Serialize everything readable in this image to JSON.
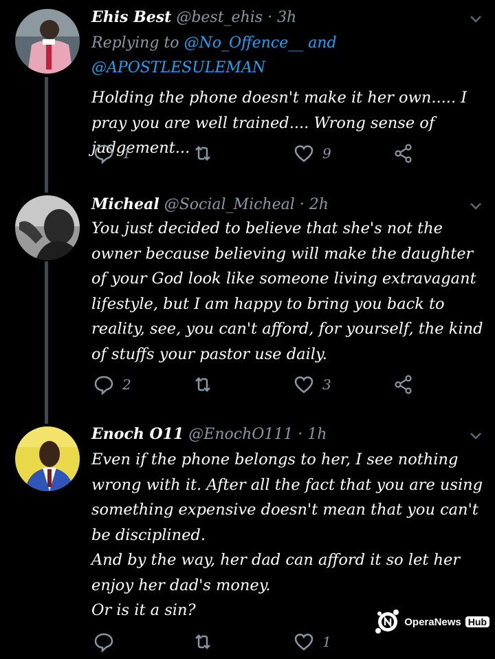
{
  "tweets": [
    {
      "name": "Ehis Best",
      "handle": "@best_ehis",
      "separator": "·",
      "time": "3h",
      "replying_prefix": "Replying to",
      "mention_1": "@No_Offence__",
      "mention_joiner": "and",
      "mention_2": "@APOSTLESULEMAN",
      "body": "Holding the phone doesn't make it her own..... I pray you are well trained.... Wrong sense of judgement...",
      "reply_count": "1",
      "retweet_count": "",
      "like_count": "9"
    },
    {
      "name": "Micheal",
      "handle": "@Social_Micheal",
      "separator": "·",
      "time": "2h",
      "body": "You just decided to believe that she's not the owner because believing will make the daughter of your God look like someone living extravagant lifestyle, but I am happy to bring you back to reality,  see, you can't afford, for yourself, the kind of stuffs your pastor use daily.",
      "reply_count": "2",
      "retweet_count": "",
      "like_count": "3"
    },
    {
      "name": "Enoch O11",
      "handle": "@EnochO111",
      "separator": "·",
      "time": "1h",
      "body": "Even if the phone belongs to her, I see nothing wrong with it. After all the fact that you are using something expensive doesn't mean that you can't be disciplined.\nAnd by the way, her dad can afford it so let her enjoy her dad's money.\nOr is it a sin?",
      "reply_count": "",
      "retweet_count": "",
      "like_count": "1"
    }
  ],
  "watermark": {
    "text": "OperaNews",
    "hub": "Hub"
  },
  "colors": {
    "background": "#000000",
    "secondary_text": "#8899a6",
    "link": "#1da1f2",
    "thread_line": "#3d4a55"
  },
  "icons": [
    "reply-icon",
    "retweet-icon",
    "like-icon",
    "share-icon",
    "chevron-down-icon"
  ]
}
